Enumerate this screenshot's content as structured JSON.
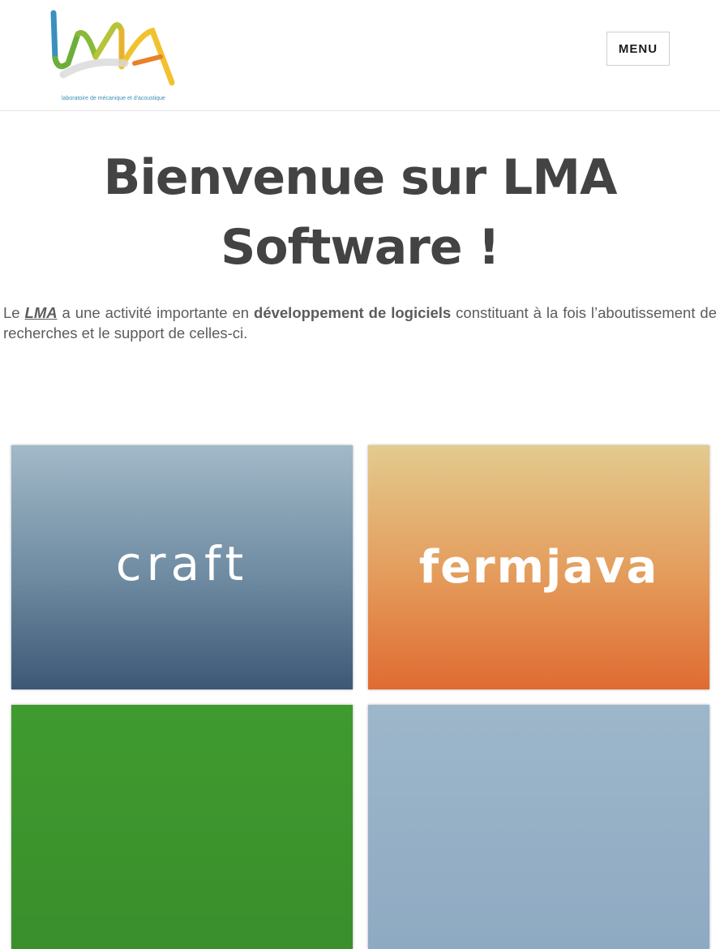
{
  "header": {
    "logo_caption": "laboratoire de mécanique et d'acoustique",
    "menu_label": "MENU"
  },
  "main": {
    "title": "Bienvenue sur LMA Software !",
    "intro": {
      "part1": "Le ",
      "link": "LMA",
      "part2": " a une activité importante en ",
      "bold": "développement de logiciels",
      "part3": " constituant à la fois l’aboutissement de recherches et le support de celles-ci."
    }
  },
  "tiles": [
    {
      "name": "craft",
      "label": "craft"
    },
    {
      "name": "fermjava",
      "label": "fermjava"
    },
    {
      "name": "green",
      "label": ""
    },
    {
      "name": "blue",
      "label": ""
    }
  ],
  "colors": {
    "logo_blue": "#3a8fbf",
    "logo_green": "#6cae3a",
    "logo_yellow": "#f2c12e",
    "logo_orange": "#e7822b",
    "craft_top": "#a2b9c8",
    "craft_bottom": "#3d5875",
    "fermjava_top": "#e3cb8e",
    "fermjava_bottom": "#e06b32",
    "green_tile": "#3f9b2f",
    "blue_tile": "#9db6ca"
  }
}
